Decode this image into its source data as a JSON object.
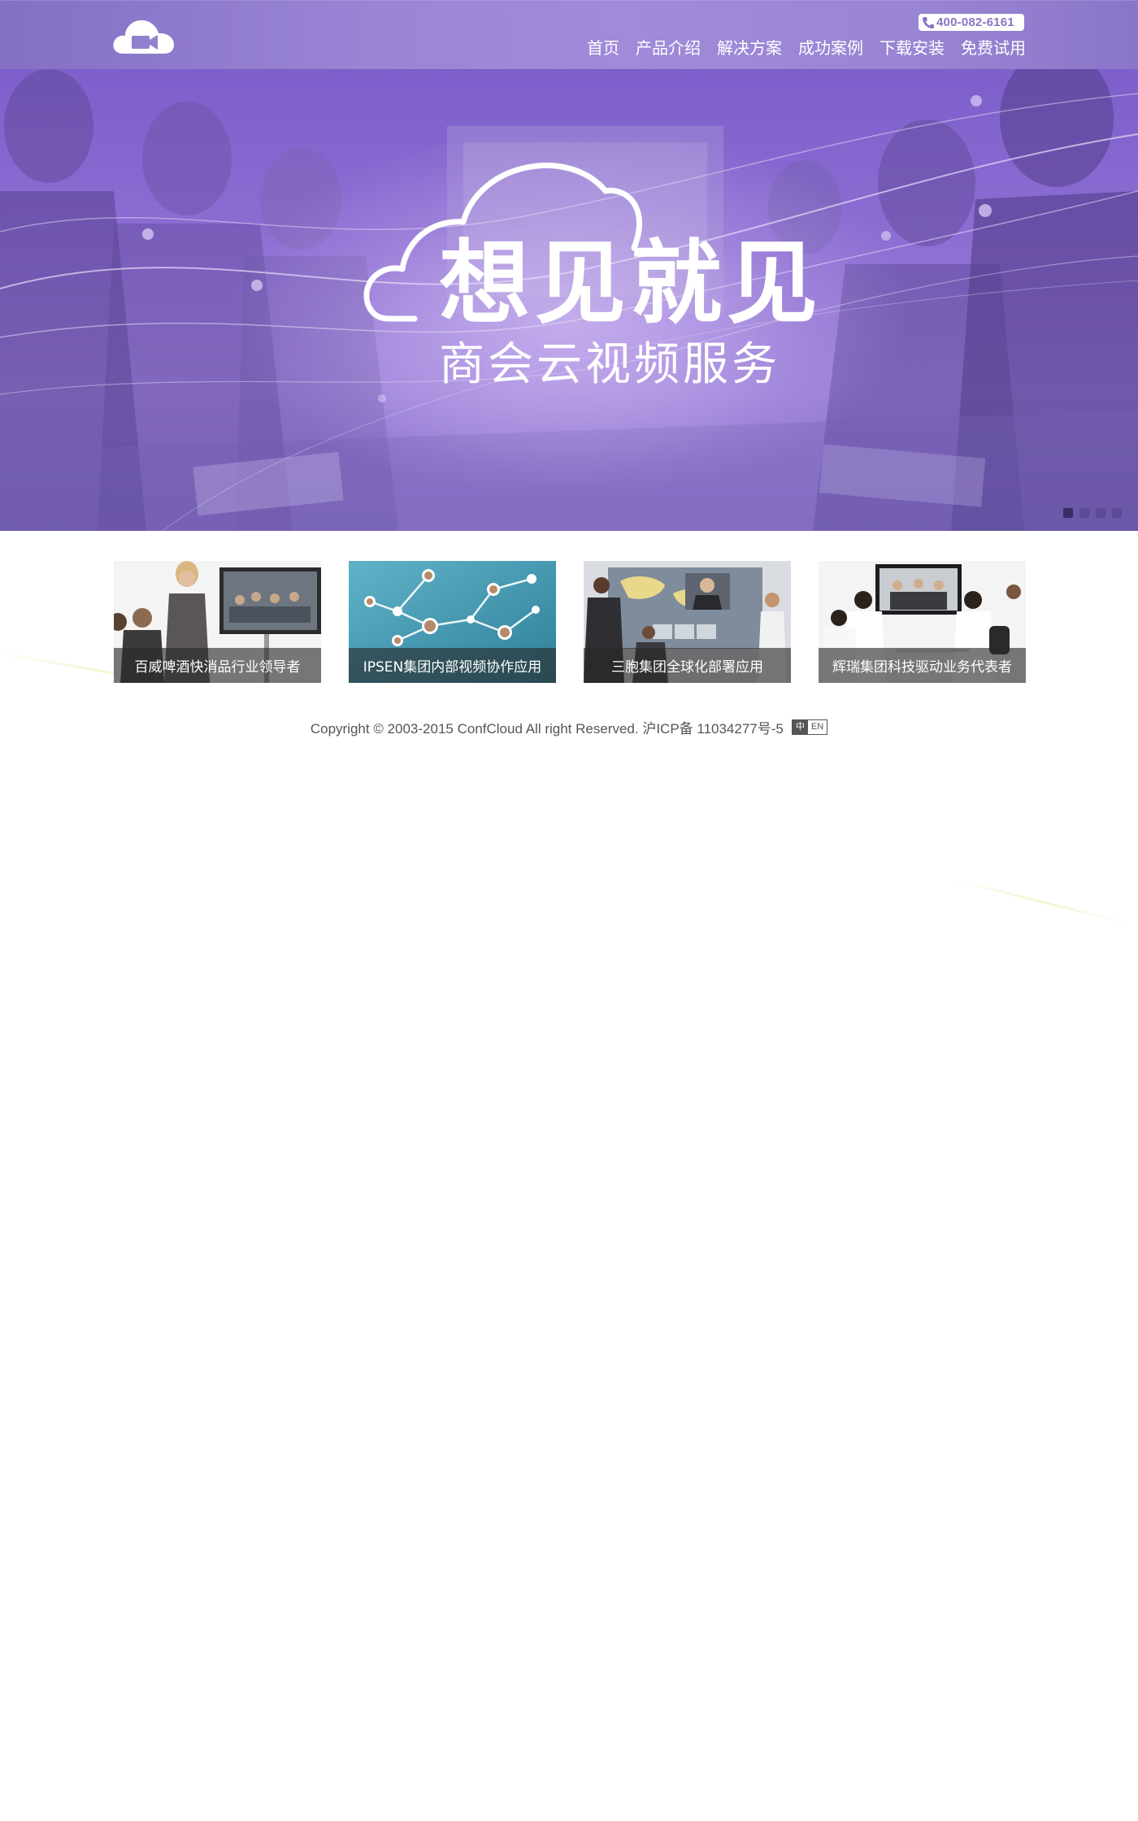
{
  "header": {
    "phone": "400-082-6161",
    "nav": [
      {
        "label": "首页"
      },
      {
        "label": "产品介绍"
      },
      {
        "label": "解决方案"
      },
      {
        "label": "成功案例"
      },
      {
        "label": "下载安装"
      },
      {
        "label": "免费试用"
      }
    ]
  },
  "hero": {
    "title": "想见就见",
    "subtitle": "商会云视频服务",
    "slides_total": 4,
    "active_slide": 1
  },
  "cases": [
    {
      "caption": "百威啤酒快消品行业领导者"
    },
    {
      "caption": "IPSEN集团内部视频协作应用"
    },
    {
      "caption": "三胞集团全球化部署应用"
    },
    {
      "caption": "辉瑞集团科技驱动业务代表者"
    }
  ],
  "footer": {
    "copyright": "Copyright © 2003-2015 ConfCloud All right Reserved. 沪ICP备 11034277号-5",
    "lang_zh": "中",
    "lang_en": "EN"
  },
  "colors": {
    "header_purple": "#9a84d4",
    "hero_purple": "#8e6fd3",
    "caption_overlay": "#282828"
  }
}
